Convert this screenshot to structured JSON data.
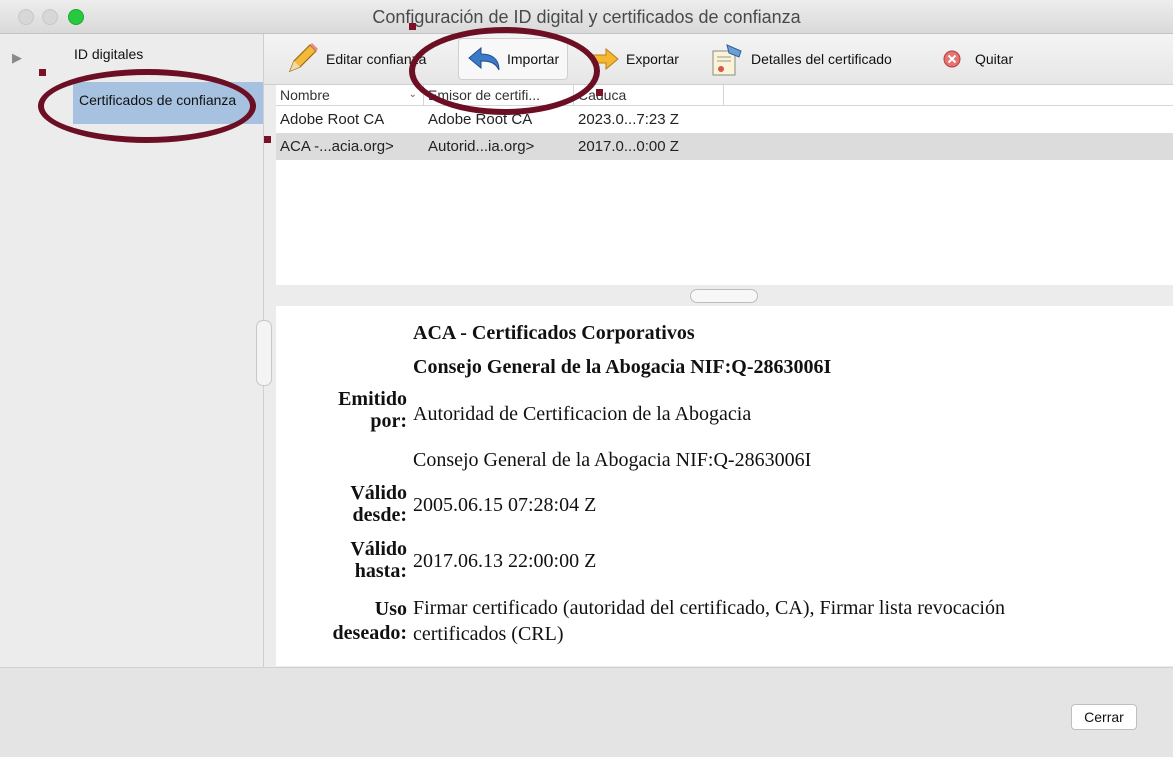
{
  "window": {
    "title": "Configuración de ID digital y certificados de confianza"
  },
  "sidebar": {
    "items": [
      {
        "label": "ID digitales"
      },
      {
        "label": "Certificados de confianza"
      }
    ]
  },
  "toolbar": {
    "edit_label": "Editar confianza",
    "import_label": "Importar",
    "export_label": "Exportar",
    "details_label": "Detalles del certificado",
    "remove_label": "Quitar"
  },
  "list": {
    "headers": [
      "Nombre",
      "Emisor de certifi...",
      "Caduca"
    ],
    "rows": [
      [
        "Adobe Root CA",
        "Adobe Root CA",
        "2023.0...7:23 Z"
      ],
      [
        "ACA -...acia.org>",
        "Autorid...ia.org>",
        "2017.0...0:00 Z"
      ]
    ],
    "selected_row": 1
  },
  "details": {
    "title_line1": "ACA - Certificados Corporativos",
    "title_line2": "Consejo General de la Abogacia NIF:Q-2863006I",
    "issued_by_label_1": "Emitido",
    "issued_by_label_2": "por:",
    "issued_by_value_1": "Autoridad de Certificacion de la Abogacia",
    "issued_by_value_2": "Consejo General de la Abogacia NIF:Q-2863006I",
    "valid_from_label_1": "Válido",
    "valid_from_label_2": "desde:",
    "valid_from_value": "2005.06.15 07:28:04 Z",
    "valid_to_label_1": "Válido",
    "valid_to_label_2": "hasta:",
    "valid_to_value": "2017.06.13 22:00:00 Z",
    "usage_label_1": "Uso",
    "usage_label_2": "deseado:",
    "usage_value_1": "Firmar certificado (autoridad del certificado, CA), Firmar lista revocación",
    "usage_value_2": "certificados (CRL)"
  },
  "footer": {
    "close_label": "Cerrar"
  },
  "colors": {
    "selection": "#a7c2e0",
    "annotation": "#6d0f24",
    "row_selected": "#dcdcdc"
  }
}
